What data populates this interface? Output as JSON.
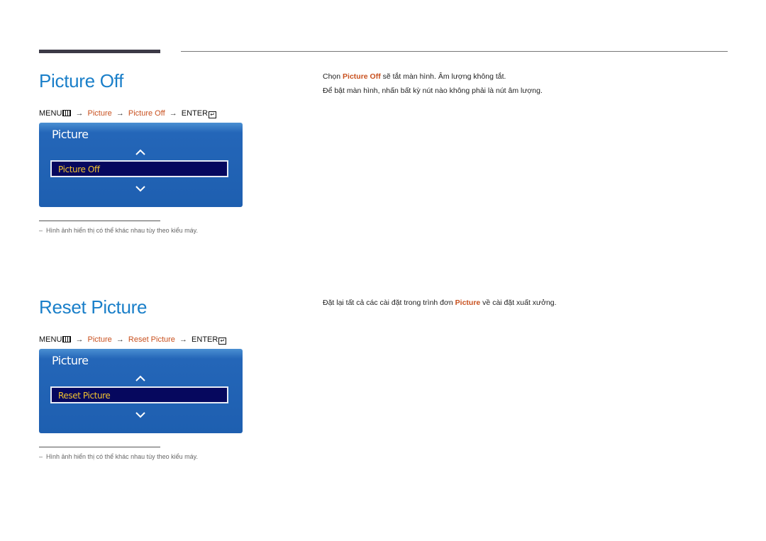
{
  "sections": [
    {
      "title": "Picture Off",
      "menu_path": {
        "menu": "MENU",
        "menu_icon": "menu-grid-icon",
        "arrow": "→",
        "step1": "Picture",
        "step2": "Picture Off",
        "enter": "ENTER",
        "enter_icon": "enter-return-icon"
      },
      "osd": {
        "title": "Picture",
        "up_icon": "chevron-up-icon",
        "selected_item": "Picture Off",
        "down_icon": "chevron-down-icon"
      },
      "note": {
        "dash": "–",
        "text": "Hình ảnh hiển thị có thể khác nhau tùy theo kiểu máy."
      },
      "description": [
        {
          "before": "Chọn ",
          "highlight": "Picture Off",
          "after": " sẽ tắt màn hình. Âm lượng không tắt."
        },
        {
          "before": "Để bật màn hình, nhấn bất kỳ nút nào không phải là nút âm lượng.",
          "highlight": "",
          "after": ""
        }
      ]
    },
    {
      "title": "Reset Picture",
      "menu_path": {
        "menu": "MENU",
        "menu_icon": "menu-grid-icon",
        "arrow": "→",
        "step1": "Picture",
        "step2": "Reset Picture",
        "enter": "ENTER",
        "enter_icon": "enter-return-icon"
      },
      "osd": {
        "title": "Picture",
        "up_icon": "chevron-up-icon",
        "selected_item": "Reset Picture",
        "down_icon": "chevron-down-icon"
      },
      "note": {
        "dash": "–",
        "text": "Hình ảnh hiển thị có thể khác nhau tùy theo kiểu máy."
      },
      "description": [
        {
          "before": "Đặt lại tất cả các cài đặt trong trình đơn ",
          "highlight": "Picture",
          "after": " về cài đặt xuất xưởng."
        }
      ]
    }
  ],
  "colors": {
    "heading": "#1a7fc9",
    "highlight": "#c8501e",
    "osd_bg": "#1e5fb0",
    "osd_selected_bg": "#06085e",
    "osd_selected_text": "#f2c230"
  }
}
